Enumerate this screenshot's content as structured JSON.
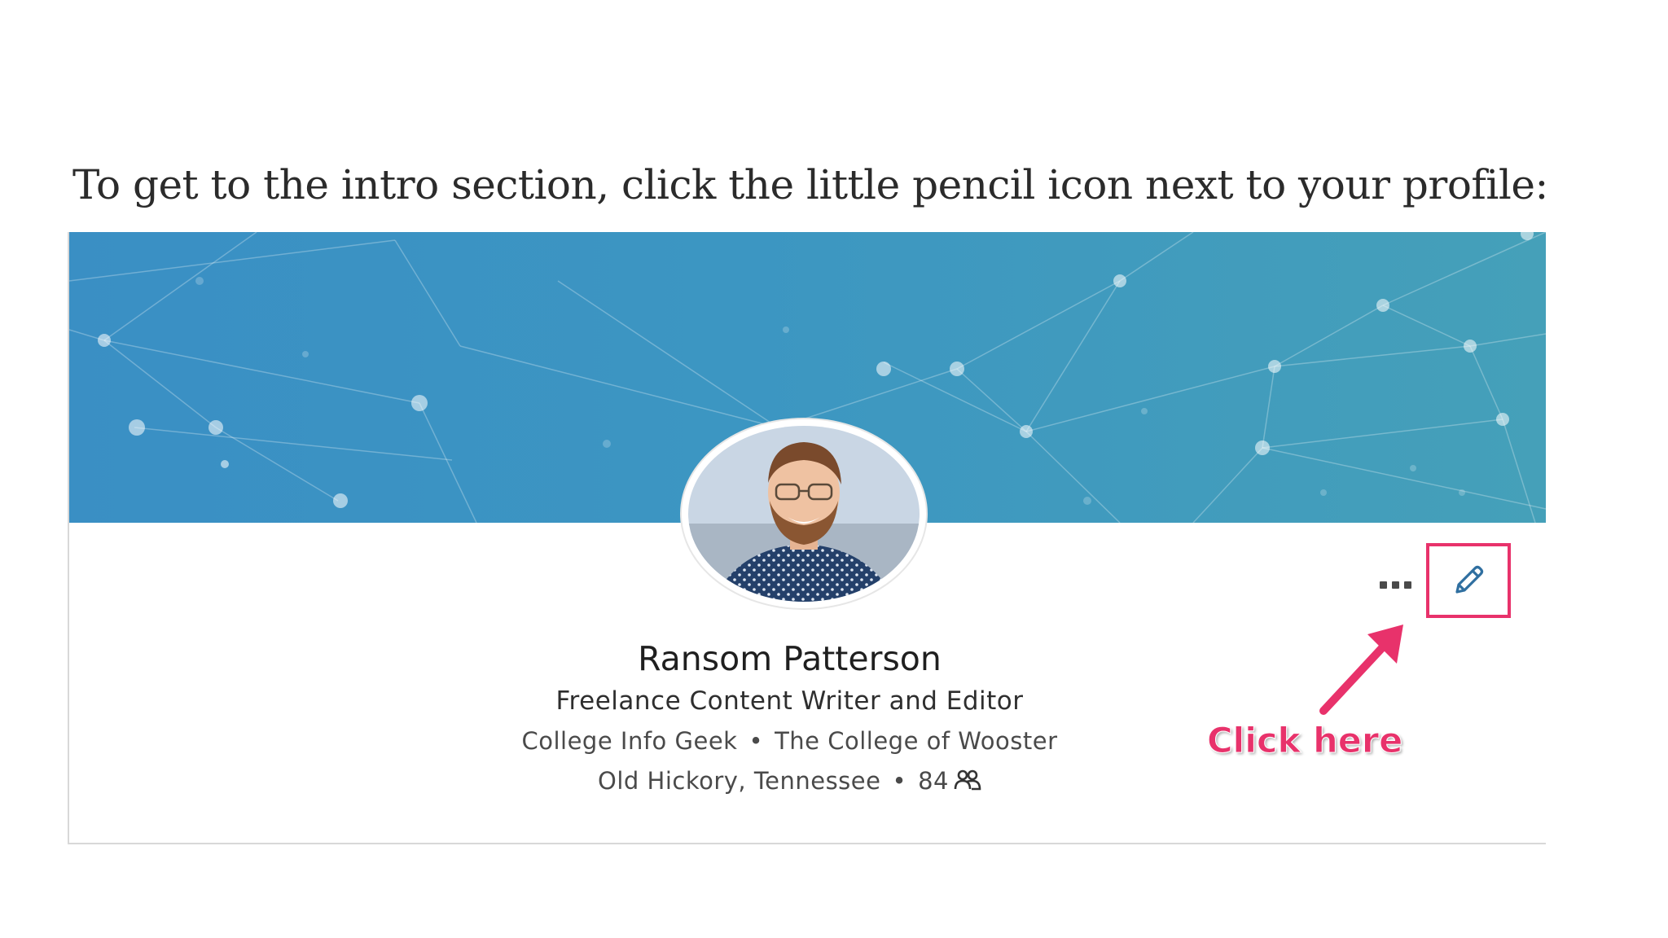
{
  "instruction": "To get to the intro section, click the little pencil icon next to your profile:",
  "profile": {
    "name": "Ransom Patterson",
    "headline": "Freelance Content Writer and Editor",
    "company": "College Info Geek",
    "school": "The College of Wooster",
    "location": "Old Hickory, Tennessee",
    "connections": "84",
    "separator": "•"
  },
  "annotation": {
    "label": "Click here",
    "color": "#e8326b"
  },
  "icons": {
    "more": "more-dots-icon",
    "edit": "pencil-icon",
    "connections": "people-icon"
  },
  "colors": {
    "banner_start": "#3a8fc4",
    "banner_end": "#45a0b9",
    "highlight": "#e8326b"
  }
}
